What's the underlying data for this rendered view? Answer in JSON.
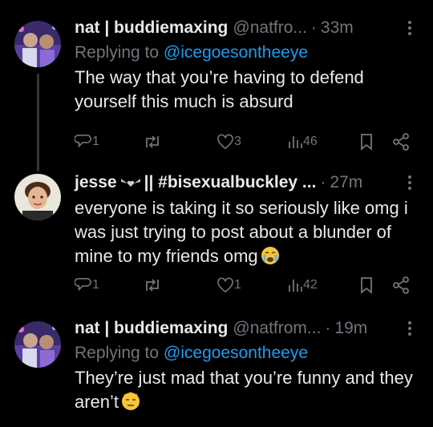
{
  "tweets": [
    {
      "name": "nat | buddiemaxing",
      "handle": "@natfro...",
      "time": "33m",
      "replying_prefix": "Replying to",
      "replying_to": "@icegoesontheeye",
      "text": "The way that you’re having to defend yourself this much is absurd",
      "replies": "1",
      "reposts": "",
      "likes": "3",
      "views": "46"
    },
    {
      "name": "jesse",
      "name_suffix": "|| #bisexualbuckley ...",
      "time": "27m",
      "text": "everyone is taking it so seriously like omg i was just trying to post about a blunder of mine to my friends omg",
      "emoji": "crying-face",
      "replies": "1",
      "reposts": "",
      "likes": "1",
      "views": "42"
    },
    {
      "name": "nat | buddiemaxing",
      "handle": "@natfrom...",
      "time": "19m",
      "replying_prefix": "Replying to",
      "replying_to": "@icegoesontheeye",
      "text": "They’re just mad that you’re funny and they aren’t",
      "emoji": "downcast-face"
    }
  ],
  "icons": [
    "reply-icon",
    "repost-icon",
    "like-icon",
    "views-icon",
    "bookmark-icon",
    "share-icon",
    "more-icon"
  ],
  "colors": {
    "background": "#000000",
    "text": "#e7e9ea",
    "muted": "#71767b",
    "link": "#1d9bf0"
  }
}
